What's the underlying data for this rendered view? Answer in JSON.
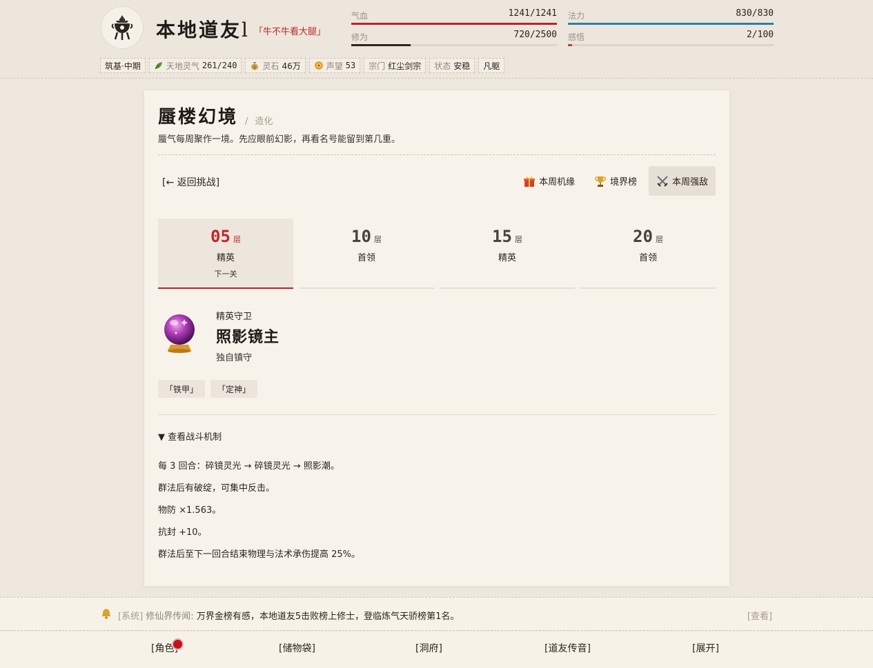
{
  "player": {
    "name": "本地道友",
    "title": "「牛不牛看大腿」",
    "stats": {
      "hp": {
        "label": "气血",
        "value": "1241/1241",
        "ratio": 1.0,
        "color": "#b8262c"
      },
      "mp": {
        "label": "法力",
        "value": "830/830",
        "ratio": 1.0,
        "color": "#2a7fa6"
      },
      "cultivation": {
        "label": "修为",
        "value": "720/2500",
        "ratio": 0.288,
        "color": "#2b2420"
      },
      "insight": {
        "label": "感悟",
        "value": "2/100",
        "ratio": 0.02,
        "color": "#b8452c"
      }
    },
    "chips": {
      "realm": "筑基·中期",
      "spirit_k": "天地灵气",
      "spirit_v": "261/240",
      "stone_k": "灵石",
      "stone_v": "46万",
      "fame_k": "声望",
      "fame_v": "53",
      "sect_k": "宗门",
      "sect_v": "红尘剑宗",
      "state_k": "状态",
      "state_v": "安稳",
      "body": "凡躯"
    }
  },
  "page": {
    "title": "蜃楼幻境",
    "sub_sep": "/",
    "sub": "造化",
    "desc": "蜃气每周聚作一境。先应眼前幻影，再看名号能留到第几重。",
    "back": "[← 返回挑战]",
    "tabs": [
      {
        "label": "本周机缘",
        "icon": "gift-icon"
      },
      {
        "label": "境界榜",
        "icon": "trophy-icon"
      },
      {
        "label": "本周强敌",
        "icon": "crossed-swords-icon"
      }
    ],
    "active_tab": 2
  },
  "floors": [
    {
      "num": "05",
      "unit": "层",
      "kind": "精英",
      "note": "下一关"
    },
    {
      "num": "10",
      "unit": "层",
      "kind": "首领",
      "note": ""
    },
    {
      "num": "15",
      "unit": "层",
      "kind": "精英",
      "note": ""
    },
    {
      "num": "20",
      "unit": "层",
      "kind": "首领",
      "note": ""
    }
  ],
  "boss": {
    "tag": "精英守卫",
    "name": "照影镜主",
    "desc": "独自镇守",
    "traits": [
      "「铁甲」",
      "「定神」"
    ],
    "mech_toggle": "▼ 查看战斗机制",
    "mechanics": [
      "每 3 回合：碎镜灵光 → 碎镜灵光 → 照影潮。",
      "群法后有破绽，可集中反击。",
      "物防 ×1.563。",
      "抗封 +10。",
      "群法后至下一回合结束物理与法术承伤提高 25%。"
    ]
  },
  "notice": {
    "tag": "[系统]",
    "source": "修仙界传闻:",
    "text": "万界金榜有感，本地道友5击败榜上修士，登临炼气天骄榜第1名。",
    "view": "[查看]"
  },
  "nav": {
    "role": "[角色]",
    "bag": "[储物袋]",
    "cave": "[洞府]",
    "friends": "[道友传音]",
    "expand": "[展开]"
  }
}
